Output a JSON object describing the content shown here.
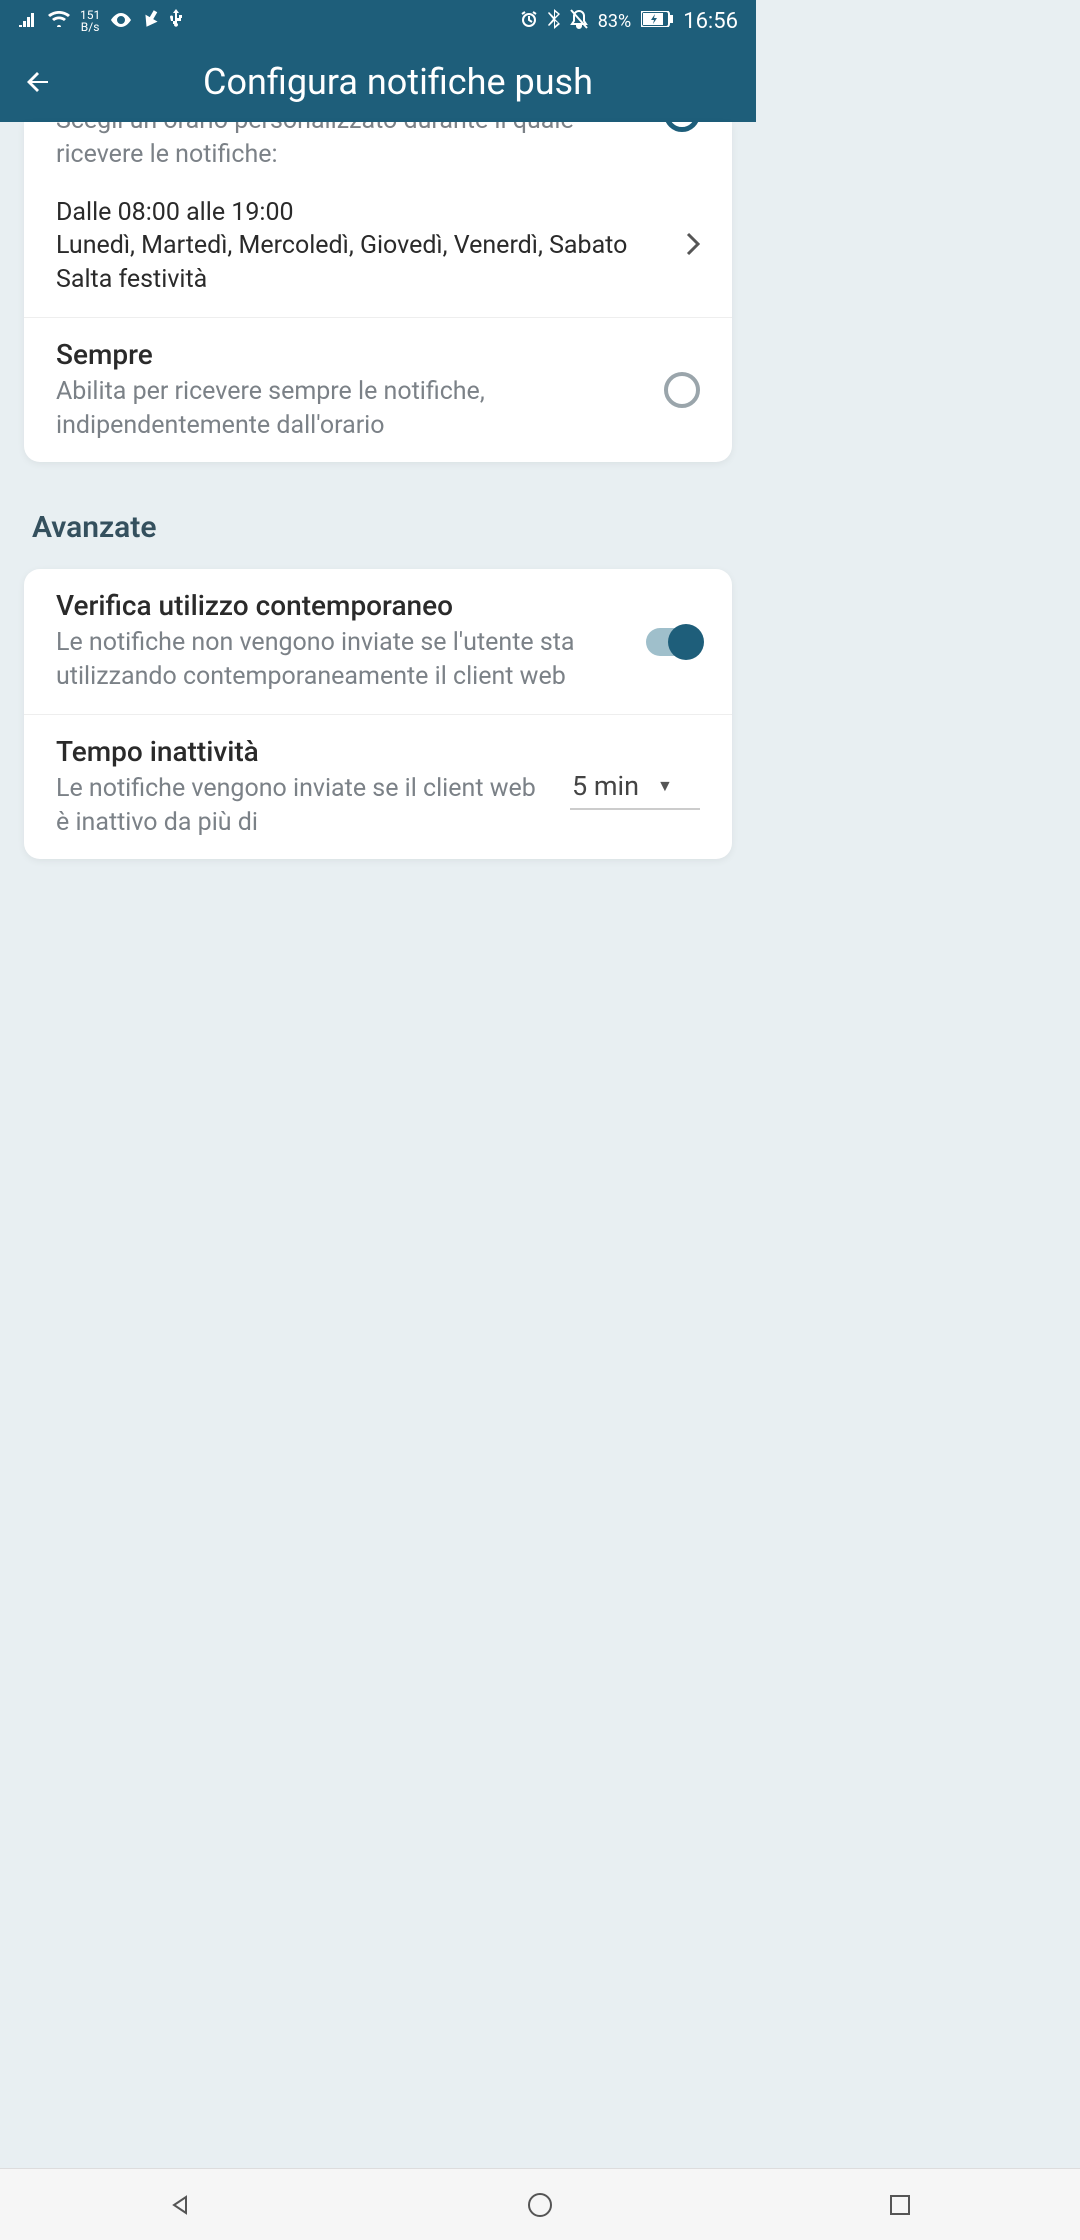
{
  "status": {
    "speed_val": "151",
    "speed_unit": "B/s",
    "battery": "83%",
    "time": "16:56"
  },
  "header": {
    "title": "Configura notifiche push"
  },
  "card1": {
    "custom": {
      "desc": "Scegli un orario personalizzato durante il quale ricevere le notifiche:"
    },
    "schedule": {
      "hours": "Dalle 08:00 alle 19:00",
      "days": "Lunedì, Martedì, Mercoledì, Giovedì, Venerdì, Sabato",
      "holidays": "Salta festività"
    },
    "always": {
      "title": "Sempre",
      "desc": "Abilita per ricevere sempre le notifiche, indipendentemente dall'orario"
    }
  },
  "section": "Avanzate",
  "card2": {
    "concurrent": {
      "title": "Verifica utilizzo contemporaneo",
      "desc": "Le notifiche non vengono inviate se l'utente sta utilizzando contemporaneamente il client web"
    },
    "inactivity": {
      "title": "Tempo inattività",
      "desc": "Le notifiche vengono inviate se il client web è inattivo da più di",
      "value": "5 min"
    }
  }
}
